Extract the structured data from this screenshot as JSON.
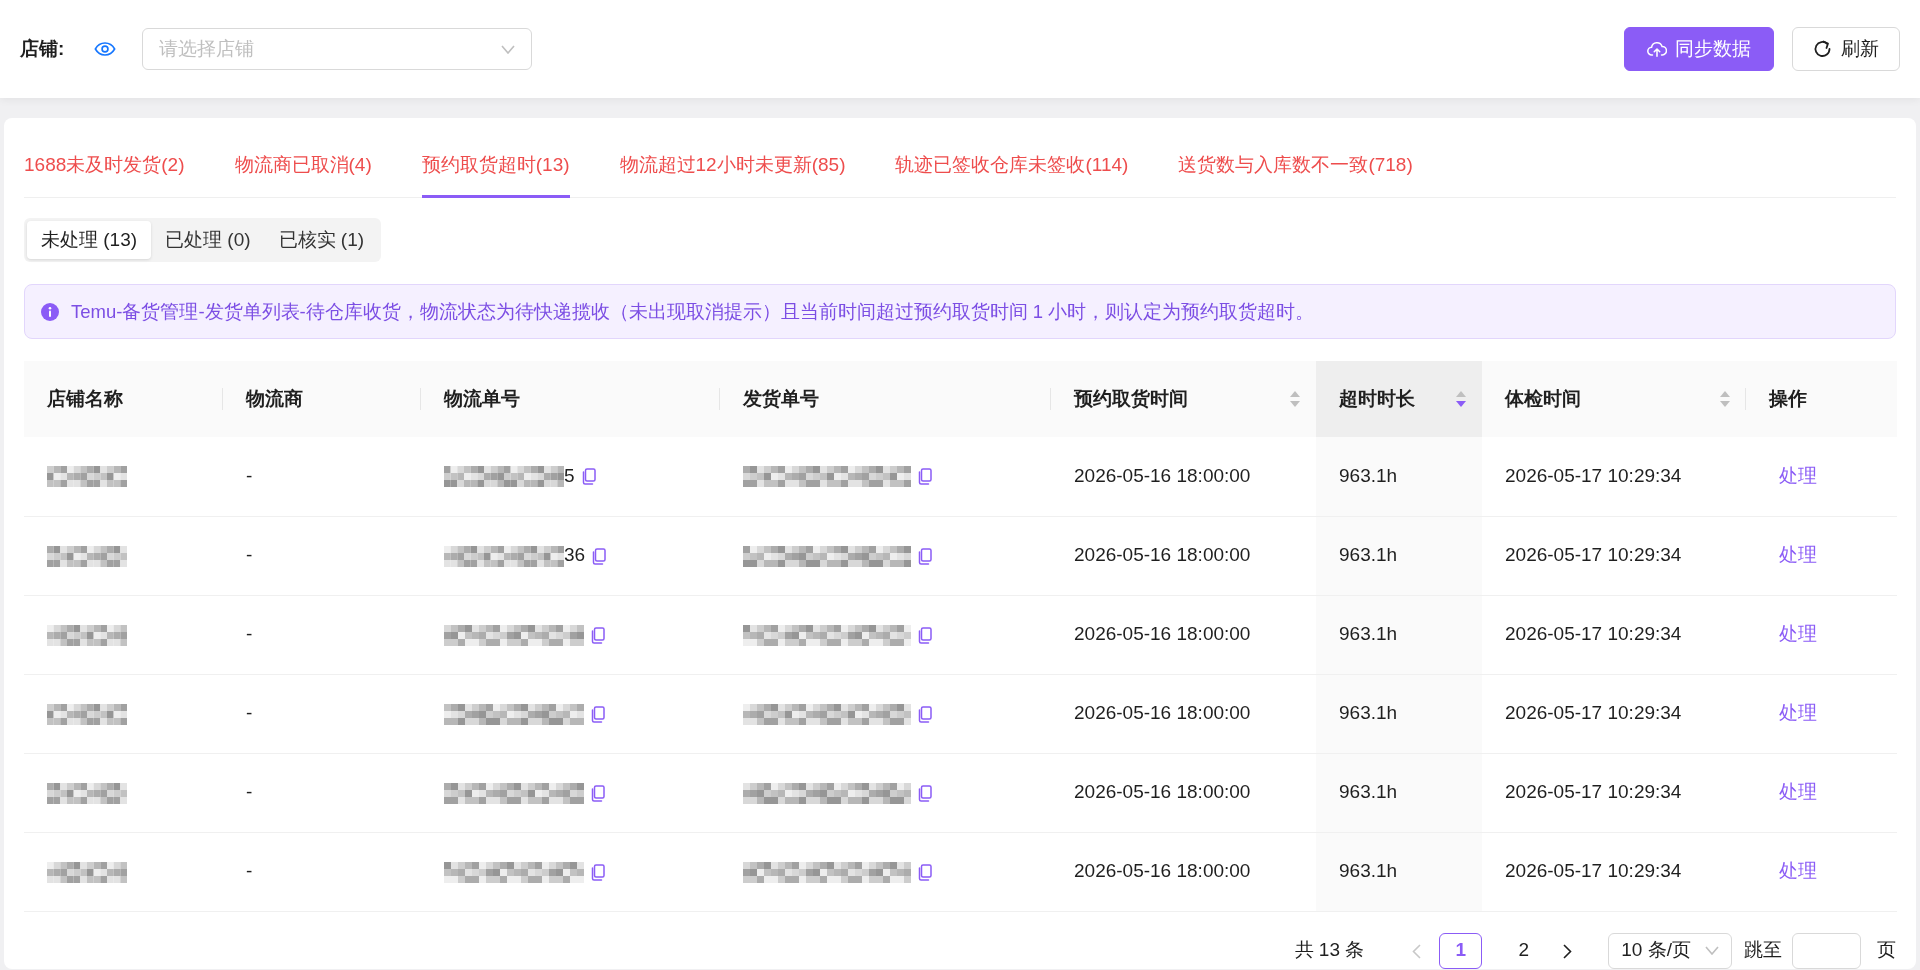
{
  "top_bar": {
    "store_label": "店铺:",
    "store_select": {
      "placeholder": "请选择店铺"
    },
    "buttons": [
      {
        "kind": "primary",
        "label": "同步数据"
      },
      {
        "kind": "default",
        "label": "刷新"
      }
    ]
  },
  "tabs": [
    {
      "label": "1688未及时发货(2)",
      "selected": false
    },
    {
      "label": "物流商已取消(4)",
      "selected": false
    },
    {
      "label": "预约取货超时(13)",
      "selected": true
    },
    {
      "label": "物流超过12小时未更新(85)",
      "selected": false
    },
    {
      "label": "轨迹已签收仓库未签收(114)",
      "selected": false
    },
    {
      "label": "送货数与入库数不一致(718)",
      "selected": false
    }
  ],
  "status_filter": [
    {
      "label": "未处理 (13)",
      "selected": true
    },
    {
      "label": "已处理 (0)",
      "selected": false
    },
    {
      "label": "已核实 (1)",
      "selected": false
    }
  ],
  "notice": "Temu-备货管理-发货单列表-待仓库收货，物流状态为待快递揽收（未出现取消提示）且当前时间超过预约取货时间 1 小时，则认定为预约取货超时。",
  "table": {
    "columns": [
      {
        "label": "店铺名称"
      },
      {
        "label": "物流商"
      },
      {
        "label": "物流单号"
      },
      {
        "label": "发货单号"
      },
      {
        "label": "预约取货时间",
        "sort_descending": false
      },
      {
        "label": "超时时长",
        "sort_descending": true
      },
      {
        "label": "体检时间",
        "sort_descending": false
      },
      {
        "label": "操作"
      }
    ],
    "rows": [
      {
        "carrier": "-",
        "tracking_no_visible": "5",
        "pickup_time": "2026-05-16 18:00:00",
        "overdue": "963.1h",
        "check_time": "2026-05-17 10:29:34",
        "action": "处理"
      },
      {
        "carrier": "-",
        "tracking_no_visible": "36",
        "pickup_time": "2026-05-16 18:00:00",
        "overdue": "963.1h",
        "check_time": "2026-05-17 10:29:34",
        "action": "处理"
      },
      {
        "carrier": "-",
        "pickup_time": "2026-05-16 18:00:00",
        "overdue": "963.1h",
        "check_time": "2026-05-17 10:29:34",
        "action": "处理"
      },
      {
        "carrier": "-",
        "pickup_time": "2026-05-16 18:00:00",
        "overdue": "963.1h",
        "check_time": "2026-05-17 10:29:34",
        "action": "处理"
      },
      {
        "carrier": "-",
        "pickup_time": "2026-05-16 18:00:00",
        "overdue": "963.1h",
        "check_time": "2026-05-17 10:29:34",
        "action": "处理"
      },
      {
        "carrier": "-",
        "pickup_time": "2026-05-16 18:00:00",
        "overdue": "963.1h",
        "check_time": "2026-05-17 10:29:34",
        "action": "处理"
      }
    ]
  },
  "pagination": {
    "total": "共 13 条",
    "prev_disabled": true,
    "pages": [
      {
        "label": "1",
        "selected": true
      },
      {
        "label": "2",
        "selected": false
      }
    ],
    "page_size": "10 条/页",
    "jump_label": "跳至",
    "jump_suffix": "页"
  }
}
